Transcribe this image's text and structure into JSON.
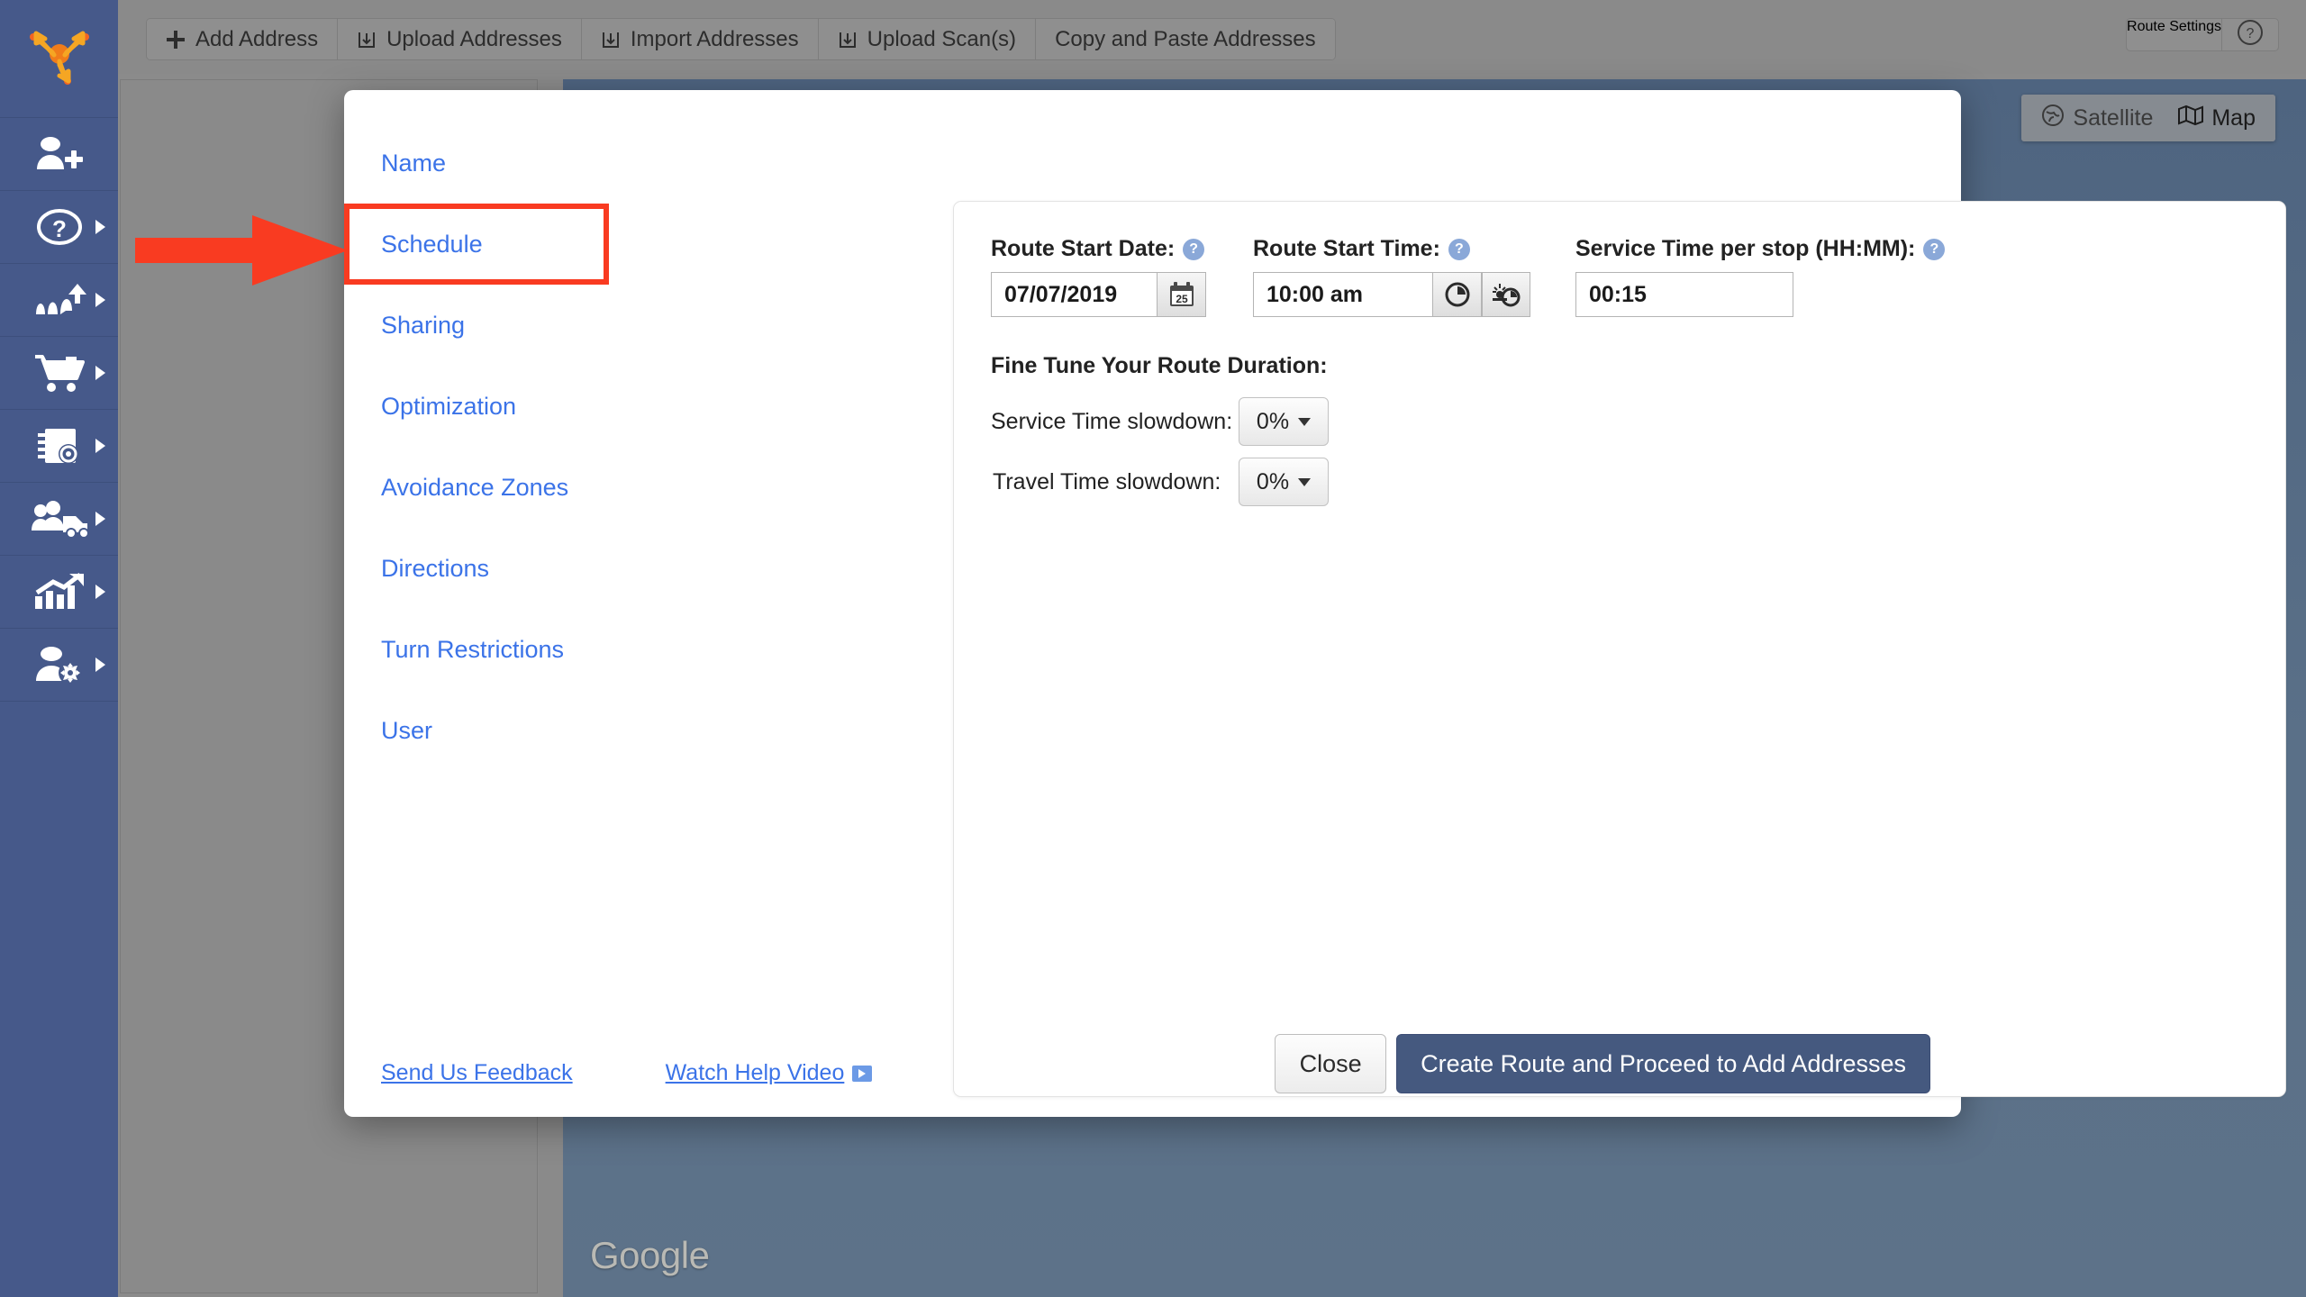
{
  "app": {
    "logo_icon": "route4me-arrows-logo"
  },
  "sidebar": {
    "items": [
      {
        "icon": "add-user-icon",
        "label": "Add User",
        "has_submenu": false
      },
      {
        "icon": "question-circle-icon",
        "label": "Help",
        "has_submenu": true
      },
      {
        "icon": "routes-icon",
        "label": "Routes",
        "has_submenu": true
      },
      {
        "icon": "shopping-cart-icon",
        "label": "Orders",
        "has_submenu": true
      },
      {
        "icon": "address-book-icon",
        "label": "Address Book",
        "has_submenu": true
      },
      {
        "icon": "team-vehicle-icon",
        "label": "Team and Vehicles",
        "has_submenu": true
      },
      {
        "icon": "analytics-chart-icon",
        "label": "Analytics",
        "has_submenu": true
      },
      {
        "icon": "user-settings-icon",
        "label": "User Settings",
        "has_submenu": true
      }
    ]
  },
  "toolbar": {
    "buttons": [
      {
        "icon": "plus-icon",
        "label": "Add Address"
      },
      {
        "icon": "upload-icon",
        "label": "Upload Addresses"
      },
      {
        "icon": "upload-icon",
        "label": "Import Addresses"
      },
      {
        "icon": "upload-icon",
        "label": "Upload Scan(s)"
      },
      {
        "icon": "none",
        "label": "Copy and Paste Addresses"
      }
    ],
    "route_settings_label": "Route Settings",
    "help_icon": "question-circle-icon"
  },
  "map": {
    "satellite_label": "Satellite",
    "satellite_icon": "globe-icon",
    "map_label": "Map",
    "map_icon": "folded-map-icon",
    "watermark": "Google"
  },
  "modal": {
    "nav": [
      {
        "label": "Name",
        "highlighted": false
      },
      {
        "label": "Schedule",
        "highlighted": true
      },
      {
        "label": "Sharing",
        "highlighted": false
      },
      {
        "label": "Optimization",
        "highlighted": false
      },
      {
        "label": "Avoidance Zones",
        "highlighted": false
      },
      {
        "label": "Directions",
        "highlighted": false
      },
      {
        "label": "Turn Restrictions",
        "highlighted": false
      },
      {
        "label": "User",
        "highlighted": false
      }
    ],
    "schedule": {
      "start_date": {
        "label": "Route Start Date:",
        "help_icon": "question-help-icon",
        "value": "07/07/2019",
        "calendar_icon": "calendar-icon",
        "calendar_day": "25"
      },
      "start_time": {
        "label": "Route Start Time:",
        "help_icon": "question-help-icon",
        "value": "10:00 am",
        "clock_icon": "clock-icon",
        "sunrise_clock_icon": "sunrise-clock-icon"
      },
      "service_time": {
        "label": "Service Time per stop (HH:MM):",
        "help_icon": "question-help-icon",
        "value": "00:15"
      },
      "fine_tune": {
        "title": "Fine Tune Your Route Duration:",
        "rows": [
          {
            "label": "Service Time slowdown:",
            "value": "0%"
          },
          {
            "label": "Travel Time slowdown:",
            "value": "0%"
          }
        ]
      }
    },
    "footer": {
      "feedback_label": "Send Us Feedback",
      "help_video_label": "Watch Help Video",
      "help_video_icon": "play-icon",
      "close_label": "Close",
      "primary_label": "Create Route and Proceed to Add Addresses"
    }
  },
  "annotation": {
    "arrow_color": "#f93b21",
    "highlight_color": "#f93b21",
    "points_at": "Schedule"
  },
  "colors": {
    "sidebar_bg": "#46598a",
    "toolbar_bg": "#8a8a8a",
    "link_blue": "#3b73e8",
    "primary_button": "#45597f",
    "map_bg": "#5a7088"
  }
}
